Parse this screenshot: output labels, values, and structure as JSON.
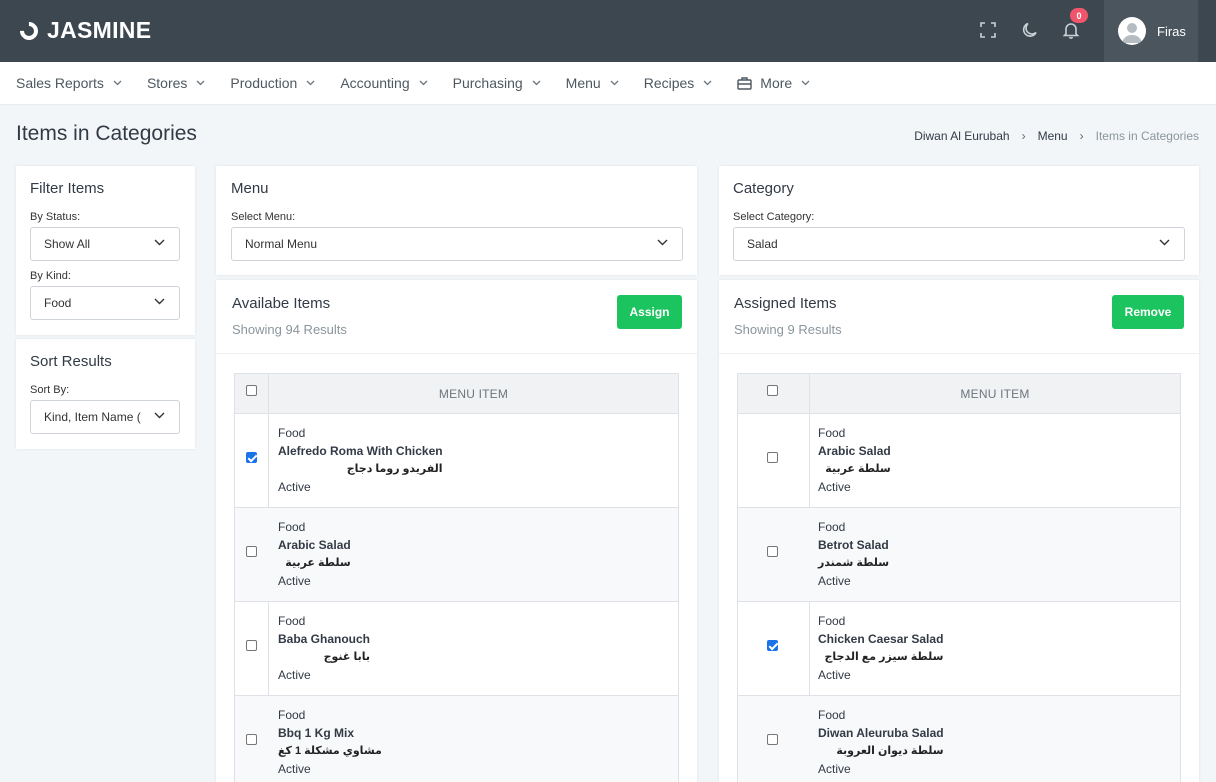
{
  "app": {
    "brand": "JASMINE"
  },
  "topbar": {
    "notification_count": "0",
    "user_name": "Firas"
  },
  "nav": [
    {
      "label": "Sales Reports"
    },
    {
      "label": "Stores"
    },
    {
      "label": "Production"
    },
    {
      "label": "Accounting"
    },
    {
      "label": "Purchasing"
    },
    {
      "label": "Menu"
    },
    {
      "label": "Recipes"
    },
    {
      "label": "More"
    }
  ],
  "page": {
    "title": "Items in Categories",
    "breadcrumb": [
      "Diwan Al Eurubah",
      "Menu",
      "Items in Categories"
    ]
  },
  "filter": {
    "title": "Filter Items",
    "status_label": "By Status:",
    "status_value": "Show All",
    "kind_label": "By Kind:",
    "kind_value": "Food"
  },
  "sort": {
    "title": "Sort Results",
    "sort_label": "Sort By:",
    "sort_value": "Kind, Item Name ("
  },
  "menu_card": {
    "title": "Menu",
    "label": "Select Menu:",
    "value": "Normal Menu"
  },
  "category_card": {
    "title": "Category",
    "label": "Select Category:",
    "value": "Salad"
  },
  "available": {
    "title": "Availabe Items",
    "count": "Showing 94 Results",
    "button": "Assign",
    "column": "MENU ITEM",
    "rows": [
      {
        "kind": "Food",
        "name": "Alefredo Roma With Chicken",
        "arabic": "الفريدو روما دجاج",
        "status": "Active",
        "checked": true
      },
      {
        "kind": "Food",
        "name": "Arabic Salad",
        "arabic": "سلطة عربية",
        "status": "Active",
        "checked": false
      },
      {
        "kind": "Food",
        "name": "Baba Ghanouch",
        "arabic": "بابا غنوج",
        "status": "Active",
        "checked": false
      },
      {
        "kind": "Food",
        "name": "Bbq 1 Kg Mix",
        "arabic": "مشاوي مشكلة 1 كغ",
        "status": "Active",
        "checked": false
      }
    ]
  },
  "assigned": {
    "title": "Assigned Items",
    "count": "Showing 9 Results",
    "button": "Remove",
    "column": "MENU ITEM",
    "rows": [
      {
        "kind": "Food",
        "name": "Arabic Salad",
        "arabic": "سلطة عربية",
        "status": "Active",
        "checked": false
      },
      {
        "kind": "Food",
        "name": "Betrot Salad",
        "arabic": "سلطة شمندر",
        "status": "Active",
        "checked": false
      },
      {
        "kind": "Food",
        "name": "Chicken Caesar Salad",
        "arabic": "سلطة سيزر مع الدجاج",
        "status": "Active",
        "checked": true
      },
      {
        "kind": "Food",
        "name": "Diwan Aleuruba Salad",
        "arabic": "سلطة ديوان العروبة",
        "status": "Active",
        "checked": false
      }
    ]
  },
  "colors": {
    "topbar": "#3c474f",
    "accent_green": "#1bc45e",
    "badge": "#f1556c",
    "checkbox": "#1a73e8"
  }
}
